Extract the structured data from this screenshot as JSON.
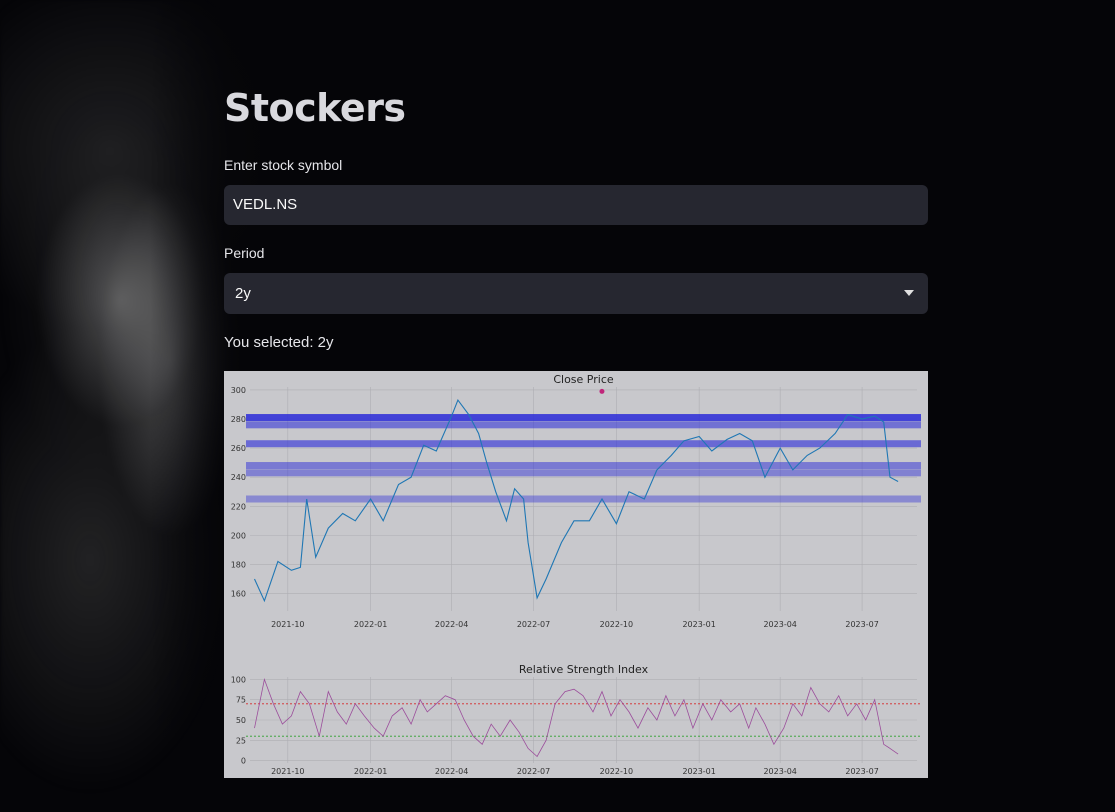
{
  "app": {
    "title": "Stockers"
  },
  "form": {
    "symbol_label": "Enter stock symbol",
    "symbol_value": "VEDL.NS",
    "period_label": "Period",
    "period_value": "2y",
    "selected_prefix": "You selected: ",
    "selected_text": "You selected: 2y"
  },
  "background": {
    "image": "person-portrait-icon"
  },
  "colors": {
    "price_line": "#1f77b4",
    "rsi_line": "#9b4d9b",
    "band": "#2a2ad8",
    "overbought": "#d62728",
    "oversold": "#2ca02c",
    "marker": "#c0257a"
  },
  "chart_data": [
    {
      "type": "line",
      "title": "Close Price",
      "xlabel": "",
      "ylabel": "",
      "xticks": [
        "2021-10",
        "2022-01",
        "2022-04",
        "2022-07",
        "2022-10",
        "2023-01",
        "2023-04",
        "2023-07"
      ],
      "yticks": [
        160,
        180,
        200,
        220,
        240,
        260,
        280,
        300
      ],
      "ylim": [
        148,
        302
      ],
      "xlim": [
        "2021-08-20",
        "2023-08-31"
      ],
      "series": [
        {
          "x": [
            "2021-08-25",
            "2021-09-05",
            "2021-09-20",
            "2021-10-05",
            "2021-10-15",
            "2021-10-22",
            "2021-11-01",
            "2021-11-15",
            "2021-12-01",
            "2021-12-15",
            "2022-01-01",
            "2022-01-15",
            "2022-02-01",
            "2022-02-15",
            "2022-03-01",
            "2022-03-15",
            "2022-04-01",
            "2022-04-08",
            "2022-04-20",
            "2022-05-01",
            "2022-05-10",
            "2022-05-20",
            "2022-06-01",
            "2022-06-10",
            "2022-06-20",
            "2022-06-25",
            "2022-07-05",
            "2022-07-15",
            "2022-08-01",
            "2022-08-15",
            "2022-09-01",
            "2022-09-15",
            "2022-10-01",
            "2022-10-15",
            "2022-11-01",
            "2022-11-15",
            "2022-12-01",
            "2022-12-15",
            "2023-01-01",
            "2023-01-15",
            "2023-02-01",
            "2023-02-15",
            "2023-03-01",
            "2023-03-15",
            "2023-04-01",
            "2023-04-15",
            "2023-05-01",
            "2023-05-15",
            "2023-06-01",
            "2023-06-15",
            "2023-07-01",
            "2023-07-15",
            "2023-07-25",
            "2023-08-01",
            "2023-08-10"
          ],
          "y": [
            170,
            155,
            182,
            176,
            178,
            225,
            185,
            205,
            215,
            210,
            225,
            210,
            235,
            240,
            262,
            258,
            282,
            293,
            283,
            270,
            250,
            230,
            210,
            232,
            225,
            195,
            157,
            170,
            195,
            210,
            210,
            225,
            208,
            230,
            225,
            245,
            255,
            265,
            268,
            258,
            266,
            270,
            265,
            240,
            260,
            245,
            255,
            260,
            270,
            283,
            280,
            282,
            278,
            240,
            237
          ]
        }
      ],
      "support_resistance_bands": [
        281,
        276,
        263,
        248,
        243,
        225
      ],
      "marker": {
        "x": "2022-09-15",
        "y": 299
      }
    },
    {
      "type": "line",
      "title": "Relative Strength Index",
      "xlabel": "",
      "ylabel": "",
      "xticks": [
        "2021-10",
        "2022-01",
        "2022-04",
        "2022-07",
        "2022-10",
        "2023-01",
        "2023-04",
        "2023-07"
      ],
      "yticks": [
        0,
        25,
        50,
        75,
        100
      ],
      "ylim": [
        -3,
        103
      ],
      "reference_lines": [
        70,
        30
      ],
      "series": [
        {
          "x": [
            "2021-08-25",
            "2021-09-05",
            "2021-09-15",
            "2021-09-25",
            "2021-10-05",
            "2021-10-15",
            "2021-10-25",
            "2021-11-05",
            "2021-11-15",
            "2021-11-25",
            "2021-12-05",
            "2021-12-15",
            "2021-12-25",
            "2022-01-05",
            "2022-01-15",
            "2022-01-25",
            "2022-02-05",
            "2022-02-15",
            "2022-02-25",
            "2022-03-05",
            "2022-03-15",
            "2022-03-25",
            "2022-04-05",
            "2022-04-15",
            "2022-04-25",
            "2022-05-05",
            "2022-05-15",
            "2022-05-25",
            "2022-06-05",
            "2022-06-15",
            "2022-06-25",
            "2022-07-05",
            "2022-07-15",
            "2022-07-25",
            "2022-08-05",
            "2022-08-15",
            "2022-08-25",
            "2022-09-05",
            "2022-09-15",
            "2022-09-25",
            "2022-10-05",
            "2022-10-15",
            "2022-10-25",
            "2022-11-05",
            "2022-11-15",
            "2022-11-25",
            "2022-12-05",
            "2022-12-15",
            "2022-12-25",
            "2023-01-05",
            "2023-01-15",
            "2023-01-25",
            "2023-02-05",
            "2023-02-15",
            "2023-02-25",
            "2023-03-05",
            "2023-03-15",
            "2023-03-25",
            "2023-04-05",
            "2023-04-15",
            "2023-04-25",
            "2023-05-05",
            "2023-05-15",
            "2023-05-25",
            "2023-06-05",
            "2023-06-15",
            "2023-06-25",
            "2023-07-05",
            "2023-07-15",
            "2023-07-25",
            "2023-08-01",
            "2023-08-10"
          ],
          "y": [
            40,
            100,
            70,
            45,
            55,
            85,
            70,
            30,
            85,
            60,
            45,
            70,
            55,
            40,
            30,
            55,
            65,
            45,
            75,
            60,
            70,
            80,
            75,
            50,
            30,
            20,
            45,
            30,
            50,
            35,
            15,
            5,
            25,
            70,
            85,
            88,
            80,
            60,
            85,
            55,
            75,
            60,
            40,
            65,
            50,
            80,
            55,
            75,
            40,
            70,
            50,
            75,
            60,
            70,
            40,
            65,
            45,
            20,
            40,
            70,
            55,
            90,
            70,
            60,
            80,
            55,
            70,
            50,
            75,
            20,
            15,
            8
          ]
        }
      ]
    }
  ]
}
